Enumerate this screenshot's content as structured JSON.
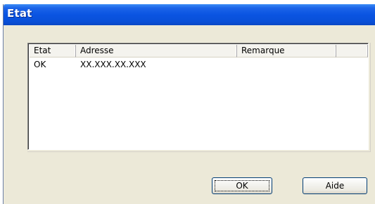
{
  "window": {
    "title": "Etat"
  },
  "listview": {
    "columns": [
      "Etat",
      "Adresse",
      "Remarque",
      ""
    ],
    "rows": [
      {
        "etat": "OK",
        "adresse": "XX.XXX.XX.XXX",
        "remarque": ""
      }
    ]
  },
  "buttons": {
    "ok_label": "OK",
    "aide_label": "Aide"
  }
}
